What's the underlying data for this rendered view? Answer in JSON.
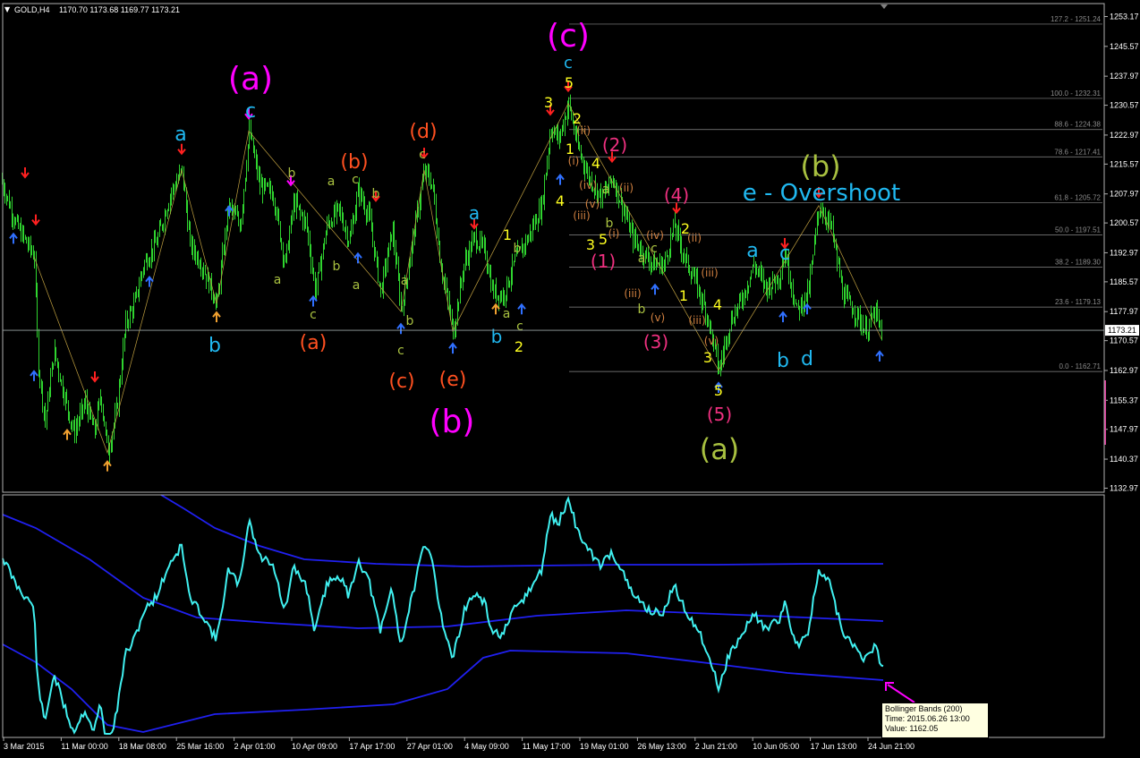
{
  "header": {
    "symbol": "GOLD,H4",
    "ohlc": "1170.70 1173.68 1169.77 1173.21",
    "arrow": "triangle-down-icon"
  },
  "colors": {
    "candle": "#2fd42f",
    "price_line": "#9aa4a4",
    "bb_line": "#2020f0",
    "osc": "#40f0f0",
    "fib_line": "#8a8a8a",
    "price_tag_bg": "#ffffff",
    "arrow_up_blue": "#3070ff",
    "arrow_down_red": "#ff2020",
    "arrow_up_orange": "#f0a030",
    "magenta": "#ff00ff",
    "cyan": "#20b8f0",
    "olive": "#a8c040",
    "orange": "#ff5020",
    "pink": "#f03080",
    "yellow": "#ffff20",
    "tan": "#d08040"
  },
  "chart_data": {
    "type": "candlestick",
    "symbol": "GOLD",
    "timeframe": "H4",
    "current_price": "1173.21",
    "y_ticks": [
      "1253.17",
      "1245.57",
      "1237.97",
      "1230.57",
      "1222.97",
      "1215.57",
      "1207.97",
      "1200.57",
      "1192.97",
      "1185.57",
      "1177.97",
      "1170.57",
      "1162.97",
      "1155.37",
      "1147.97",
      "1140.37",
      "1132.97"
    ],
    "x_ticks": [
      "3 Mar 2015",
      "11 Mar 00:00",
      "18 Mar 08:00",
      "25 Mar 16:00",
      "2 Apr 01:00",
      "10 Apr 09:00",
      "17 Apr 17:00",
      "27 Apr 01:00",
      "4 May 09:00",
      "11 May 17:00",
      "19 May 01:00",
      "26 May 13:00",
      "2 Jun 21:00",
      "10 Jun 05:00",
      "17 Jun 13:00",
      "24 Jun 21:00"
    ],
    "price_path": [
      [
        0,
        1212
      ],
      [
        18,
        1200
      ],
      [
        38,
        1192
      ],
      [
        42,
        1165
      ],
      [
        50,
        1150
      ],
      [
        60,
        1168
      ],
      [
        70,
        1158
      ],
      [
        82,
        1147
      ],
      [
        95,
        1155
      ],
      [
        105,
        1147
      ],
      [
        112,
        1157
      ],
      [
        120,
        1142
      ],
      [
        130,
        1153
      ],
      [
        140,
        1175
      ],
      [
        150,
        1180
      ],
      [
        160,
        1190
      ],
      [
        175,
        1196
      ],
      [
        190,
        1208
      ],
      [
        203,
        1214
      ],
      [
        212,
        1195
      ],
      [
        225,
        1190
      ],
      [
        242,
        1180
      ],
      [
        255,
        1205
      ],
      [
        268,
        1200
      ],
      [
        278,
        1224
      ],
      [
        290,
        1210
      ],
      [
        305,
        1208
      ],
      [
        318,
        1190
      ],
      [
        328,
        1206
      ],
      [
        342,
        1200
      ],
      [
        352,
        1183
      ],
      [
        365,
        1200
      ],
      [
        378,
        1204
      ],
      [
        390,
        1196
      ],
      [
        400,
        1209
      ],
      [
        412,
        1202
      ],
      [
        425,
        1183
      ],
      [
        438,
        1199
      ],
      [
        448,
        1178
      ],
      [
        462,
        1198
      ],
      [
        474,
        1214
      ],
      [
        483,
        1210
      ],
      [
        492,
        1190
      ],
      [
        506,
        1173
      ],
      [
        518,
        1190
      ],
      [
        530,
        1197
      ],
      [
        542,
        1193
      ],
      [
        550,
        1183
      ],
      [
        562,
        1182
      ],
      [
        575,
        1191
      ],
      [
        590,
        1197
      ],
      [
        605,
        1205
      ],
      [
        615,
        1225
      ],
      [
        624,
        1222
      ],
      [
        635,
        1231
      ],
      [
        645,
        1220
      ],
      [
        658,
        1212
      ],
      [
        672,
        1207
      ],
      [
        684,
        1212
      ],
      [
        695,
        1205
      ],
      [
        706,
        1197
      ],
      [
        718,
        1193
      ],
      [
        730,
        1190
      ],
      [
        742,
        1190
      ],
      [
        753,
        1200
      ],
      [
        764,
        1192
      ],
      [
        776,
        1186
      ],
      [
        790,
        1177
      ],
      [
        803,
        1163
      ],
      [
        815,
        1175
      ],
      [
        830,
        1182
      ],
      [
        842,
        1190
      ],
      [
        856,
        1184
      ],
      [
        870,
        1187
      ],
      [
        877,
        1193
      ],
      [
        890,
        1178
      ],
      [
        903,
        1183
      ],
      [
        915,
        1205
      ],
      [
        928,
        1200
      ],
      [
        942,
        1182
      ],
      [
        955,
        1178
      ],
      [
        967,
        1173
      ],
      [
        978,
        1178
      ],
      [
        985,
        1171
      ]
    ],
    "fibonacci_levels": [
      {
        "ratio": "127.2",
        "price": "1251.24"
      },
      {
        "ratio": "100.0",
        "price": "1232.31"
      },
      {
        "ratio": "88.6",
        "price": "1224.38"
      },
      {
        "ratio": "78.6",
        "price": "1217.41"
      },
      {
        "ratio": "61.8",
        "price": "1205.72"
      },
      {
        "ratio": "50.0",
        "price": "1197.51"
      },
      {
        "ratio": "38.2",
        "price": "1189.30"
      },
      {
        "ratio": "23.6",
        "price": "1179.13"
      },
      {
        "ratio": "0.0",
        "price": "1162.71"
      }
    ],
    "wave_labels": [
      {
        "t": "(a)",
        "c": "magenta",
        "s": 36,
        "x": 280,
        "y": 100
      },
      {
        "t": "(b)",
        "c": "magenta",
        "s": 36,
        "x": 505,
        "y": 483
      },
      {
        "t": "(c)",
        "c": "magenta",
        "s": 36,
        "x": 635,
        "y": 52
      },
      {
        "t": "a",
        "c": "cyan",
        "s": 22,
        "x": 202,
        "y": 157
      },
      {
        "t": "c",
        "c": "cyan",
        "s": 22,
        "x": 280,
        "y": 131
      },
      {
        "t": "b",
        "c": "cyan",
        "s": 22,
        "x": 240,
        "y": 393
      },
      {
        "t": "a",
        "c": "cyan",
        "s": 20,
        "x": 530,
        "y": 245
      },
      {
        "t": "b",
        "c": "cyan",
        "s": 20,
        "x": 555,
        "y": 383
      },
      {
        "t": "c",
        "c": "cyan",
        "s": 18,
        "x": 635,
        "y": 76
      },
      {
        "t": "a",
        "c": "cyan",
        "s": 22,
        "x": 841,
        "y": 287
      },
      {
        "t": "c",
        "c": "cyan",
        "s": 22,
        "x": 877,
        "y": 290
      },
      {
        "t": "b",
        "c": "cyan",
        "s": 22,
        "x": 875,
        "y": 410
      },
      {
        "t": "d",
        "c": "cyan",
        "s": 22,
        "x": 902,
        "y": 408
      },
      {
        "t": "e - Overshoot",
        "c": "cyan",
        "s": 26,
        "x": 918,
        "y": 224
      },
      {
        "t": "(d)",
        "c": "orange",
        "s": 22,
        "x": 473,
        "y": 154
      },
      {
        "t": "(b)",
        "c": "orange",
        "s": 22,
        "x": 396,
        "y": 188
      },
      {
        "t": "(a)",
        "c": "orange",
        "s": 22,
        "x": 350,
        "y": 390
      },
      {
        "t": "(c)",
        "c": "orange",
        "s": 22,
        "x": 449,
        "y": 433
      },
      {
        "t": "(e)",
        "c": "orange",
        "s": 22,
        "x": 506,
        "y": 431
      },
      {
        "t": "(2)",
        "c": "pink",
        "s": 20,
        "x": 687,
        "y": 169
      },
      {
        "t": "(4)",
        "c": "pink",
        "s": 20,
        "x": 756,
        "y": 225
      },
      {
        "t": "(1)",
        "c": "pink",
        "s": 20,
        "x": 674,
        "y": 299
      },
      {
        "t": "(3)",
        "c": "pink",
        "s": 20,
        "x": 733,
        "y": 389
      },
      {
        "t": "(5)",
        "c": "pink",
        "s": 20,
        "x": 804,
        "y": 470
      },
      {
        "t": "(b)",
        "c": "olive",
        "s": 32,
        "x": 917,
        "y": 197
      },
      {
        "t": "(a)",
        "c": "olive",
        "s": 32,
        "x": 804,
        "y": 513
      },
      {
        "t": "c",
        "c": "olive",
        "s": 14,
        "x": 472,
        "y": 177
      },
      {
        "t": "b",
        "c": "olive",
        "s": 14,
        "x": 326,
        "y": 198
      },
      {
        "t": "a",
        "c": "olive",
        "s": 14,
        "x": 370,
        "y": 207
      },
      {
        "t": "c",
        "c": "olive",
        "s": 14,
        "x": 397,
        "y": 205
      },
      {
        "t": "b",
        "c": "olive",
        "s": 14,
        "x": 420,
        "y": 221
      },
      {
        "t": "a",
        "c": "olive",
        "s": 14,
        "x": 310,
        "y": 317
      },
      {
        "t": "b",
        "c": "olive",
        "s": 14,
        "x": 376,
        "y": 302
      },
      {
        "t": "a",
        "c": "olive",
        "s": 14,
        "x": 398,
        "y": 323
      },
      {
        "t": "c",
        "c": "olive",
        "s": 14,
        "x": 350,
        "y": 356
      },
      {
        "t": "a",
        "c": "olive",
        "s": 14,
        "x": 452,
        "y": 318
      },
      {
        "t": "b",
        "c": "olive",
        "s": 14,
        "x": 458,
        "y": 363
      },
      {
        "t": "c",
        "c": "olive",
        "s": 14,
        "x": 448,
        "y": 396
      },
      {
        "t": "b",
        "c": "olive",
        "s": 14,
        "x": 578,
        "y": 282
      },
      {
        "t": "a",
        "c": "olive",
        "s": 14,
        "x": 566,
        "y": 355
      },
      {
        "t": "c",
        "c": "olive",
        "s": 14,
        "x": 581,
        "y": 369
      },
      {
        "t": "a",
        "c": "olive",
        "s": 14,
        "x": 677,
        "y": 216
      },
      {
        "t": "b",
        "c": "olive",
        "s": 14,
        "x": 681,
        "y": 254
      },
      {
        "t": "a",
        "c": "olive",
        "s": 14,
        "x": 717,
        "y": 293
      },
      {
        "t": "b",
        "c": "olive",
        "s": 14,
        "x": 717,
        "y": 350
      },
      {
        "t": "c",
        "c": "olive",
        "s": 14,
        "x": 731,
        "y": 282
      },
      {
        "t": "3",
        "c": "yellow",
        "s": 16,
        "x": 613,
        "y": 120
      },
      {
        "t": "5",
        "c": "yellow",
        "s": 16,
        "x": 636,
        "y": 98
      },
      {
        "t": "2",
        "c": "yellow",
        "s": 16,
        "x": 645,
        "y": 138
      },
      {
        "t": "1",
        "c": "yellow",
        "s": 16,
        "x": 637,
        "y": 172
      },
      {
        "t": "4",
        "c": "yellow",
        "s": 16,
        "x": 666,
        "y": 188
      },
      {
        "t": "4",
        "c": "yellow",
        "s": 16,
        "x": 626,
        "y": 230
      },
      {
        "t": "3",
        "c": "yellow",
        "s": 16,
        "x": 660,
        "y": 279
      },
      {
        "t": "5",
        "c": "yellow",
        "s": 16,
        "x": 674,
        "y": 273
      },
      {
        "t": "1",
        "c": "yellow",
        "s": 16,
        "x": 567,
        "y": 268
      },
      {
        "t": "2",
        "c": "yellow",
        "s": 16,
        "x": 580,
        "y": 393
      },
      {
        "t": "2",
        "c": "yellow",
        "s": 16,
        "x": 766,
        "y": 261
      },
      {
        "t": "1",
        "c": "yellow",
        "s": 16,
        "x": 764,
        "y": 336
      },
      {
        "t": "4",
        "c": "yellow",
        "s": 16,
        "x": 802,
        "y": 346
      },
      {
        "t": "3",
        "c": "yellow",
        "s": 16,
        "x": 791,
        "y": 405
      },
      {
        "t": "5",
        "c": "yellow",
        "s": 16,
        "x": 803,
        "y": 442
      },
      {
        "t": "(ii)",
        "c": "tan",
        "s": 12,
        "x": 652,
        "y": 150
      },
      {
        "t": "(i)",
        "c": "tan",
        "s": 12,
        "x": 641,
        "y": 184
      },
      {
        "t": "(iv)",
        "c": "tan",
        "s": 12,
        "x": 657,
        "y": 211
      },
      {
        "t": "(iii)",
        "c": "tan",
        "s": 12,
        "x": 650,
        "y": 245
      },
      {
        "t": "(v)",
        "c": "tan",
        "s": 12,
        "x": 662,
        "y": 232
      },
      {
        "t": "(i)",
        "c": "tan",
        "s": 12,
        "x": 686,
        "y": 265
      },
      {
        "t": "(ii)",
        "c": "tan",
        "s": 12,
        "x": 700,
        "y": 214
      },
      {
        "t": "(iv)",
        "c": "tan",
        "s": 12,
        "x": 732,
        "y": 267
      },
      {
        "t": "(v)",
        "c": "tan",
        "s": 12,
        "x": 735,
        "y": 359
      },
      {
        "t": "(iii)",
        "c": "tan",
        "s": 12,
        "x": 707,
        "y": 332
      },
      {
        "t": "(iii)",
        "c": "tan",
        "s": 12,
        "x": 793,
        "y": 309
      },
      {
        "t": "(ii)",
        "c": "tan",
        "s": 12,
        "x": 776,
        "y": 270
      },
      {
        "t": "(iii)",
        "c": "tan",
        "s": 12,
        "x": 779,
        "y": 362
      },
      {
        "t": "(v)",
        "c": "tan",
        "s": 12,
        "x": 795,
        "y": 385
      }
    ]
  },
  "indicator": {
    "name": "Bollinger Bands (200)",
    "tooltip": {
      "line1": "Bollinger Bands (200)",
      "line2": "Time: 2015.06.26 13:00",
      "line3": "Value: 1162.05"
    },
    "pointer_icon": "magenta-arrow-icon"
  }
}
